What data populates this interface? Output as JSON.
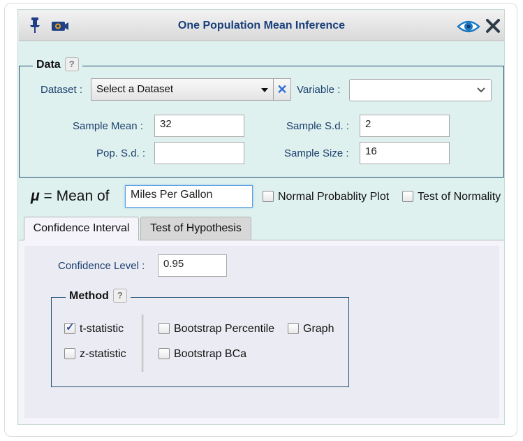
{
  "window": {
    "title": "One Population Mean Inference",
    "icons": [
      "pin-icon",
      "camera-icon",
      "eye-icon",
      "close-icon"
    ]
  },
  "data_section": {
    "legend": "Data",
    "help": "?",
    "dataset_label": "Dataset :",
    "dataset_value": "Select a Dataset",
    "variable_label": "Variable :",
    "variable_value": "",
    "sample_mean_label": "Sample Mean :",
    "sample_mean_value": "32",
    "sample_sd_label": "Sample S.d. :",
    "sample_sd_value": "2",
    "pop_sd_label": "Pop. S.d. :",
    "pop_sd_value": "",
    "sample_size_label": "Sample Size :",
    "sample_size_value": "16"
  },
  "mean_row": {
    "mu_symbol": "μ",
    "label": "= Mean of",
    "value": "Miles Per Gallon",
    "normal_plot_label": "Normal Probablity Plot",
    "normal_plot_checked": false,
    "normality_test_label": "Test of Normality",
    "normality_test_checked": false
  },
  "tabs": [
    {
      "label": "Confidence Interval",
      "active": true
    },
    {
      "label": "Test of Hypothesis",
      "active": false
    }
  ],
  "ci": {
    "confidence_level_label": "Confidence Level :",
    "confidence_level_value": "0.95",
    "method": {
      "legend": "Method",
      "help": "?",
      "t_statistic_label": "t-statistic",
      "t_statistic_checked": true,
      "z_statistic_label": "z-statistic",
      "z_statistic_checked": false,
      "bootstrap_percentile_label": "Bootstrap Percentile",
      "bootstrap_percentile_checked": false,
      "graph_label": "Graph",
      "graph_checked": false,
      "bootstrap_bca_label": "Bootstrap BCa",
      "bootstrap_bca_checked": false
    }
  },
  "colors": {
    "panel_bg": "#dff1ee",
    "title_text": "#1a3f7a",
    "label_text": "#1c3f6e",
    "border_blue": "#1c4d74",
    "clear_x": "#2f6fd6"
  }
}
